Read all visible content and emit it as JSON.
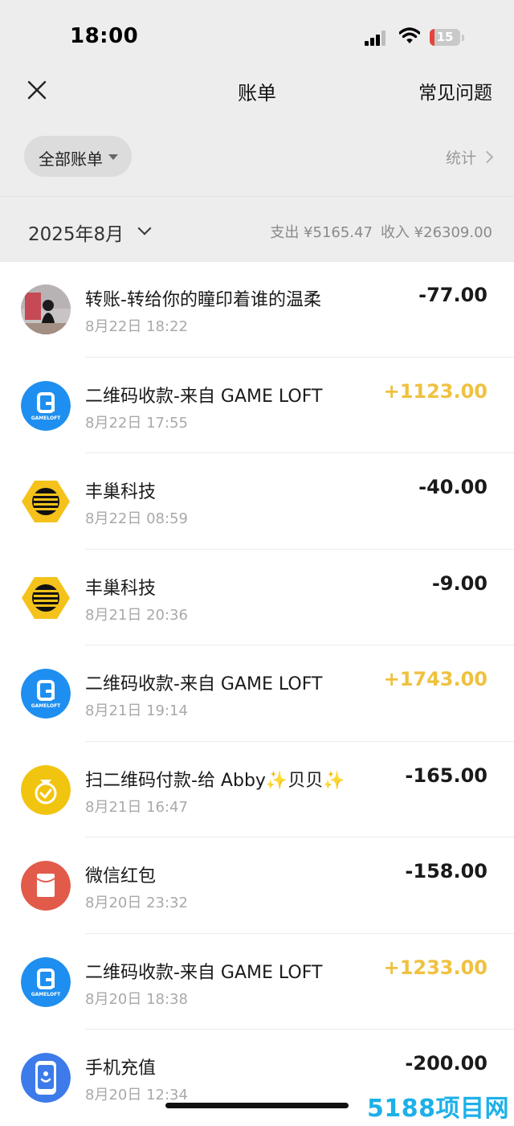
{
  "status_bar": {
    "time": "18:00",
    "battery_level": "15",
    "battery_fraction": 0.15,
    "battery_color": "#e5443c"
  },
  "nav": {
    "title": "账单",
    "faq": "常见问题"
  },
  "filter": {
    "label": "全部账单",
    "stats": "统计"
  },
  "period": {
    "month": "2025年8月",
    "expense": "支出 ¥5165.47",
    "income": "收入 ¥26309.00"
  },
  "colors": {
    "income": "#efc13f",
    "gameloft": "#1e8ff0",
    "fengchao": "#f4c21b",
    "scan_pay": "#f1c40f",
    "red_packet": "#e15a4a",
    "recharge": "#3d7bea"
  },
  "transactions": [
    {
      "icon": "user-photo",
      "name": "转账-转给你的瞳印着谁的温柔",
      "time": "8月22日 18:22",
      "amount": "-77.00",
      "type": "expense"
    },
    {
      "icon": "gameloft-logo",
      "name": "二维码收款-来自 GAME LOFT",
      "time": "8月22日 17:55",
      "amount": "+1123.00",
      "type": "income",
      "logo_text": "GAMELOFT"
    },
    {
      "icon": "fengchao-logo",
      "name": "丰巢科技",
      "time": "8月22日 08:59",
      "amount": "-40.00",
      "type": "expense"
    },
    {
      "icon": "fengchao-logo",
      "name": "丰巢科技",
      "time": "8月21日 20:36",
      "amount": "-9.00",
      "type": "expense"
    },
    {
      "icon": "gameloft-logo",
      "name": "二维码收款-来自 GAME LOFT",
      "time": "8月21日 19:14",
      "amount": "+1743.00",
      "type": "income",
      "logo_text": "GAMELOFT"
    },
    {
      "icon": "money-bag-icon",
      "name": "扫二维码付款-给 Abby✨贝贝✨",
      "time": "8月21日 16:47",
      "amount": "-165.00",
      "type": "expense"
    },
    {
      "icon": "red-packet-icon",
      "name": "微信红包",
      "time": "8月20日 23:32",
      "amount": "-158.00",
      "type": "expense"
    },
    {
      "icon": "gameloft-logo",
      "name": "二维码收款-来自 GAME LOFT",
      "time": "8月20日 18:38",
      "amount": "+1233.00",
      "type": "income",
      "logo_text": "GAMELOFT"
    },
    {
      "icon": "phone-recharge-icon",
      "name": "手机充值",
      "time": "8月20日 12:34",
      "amount": "-200.00",
      "type": "expense"
    }
  ],
  "watermark": "5188项目网"
}
